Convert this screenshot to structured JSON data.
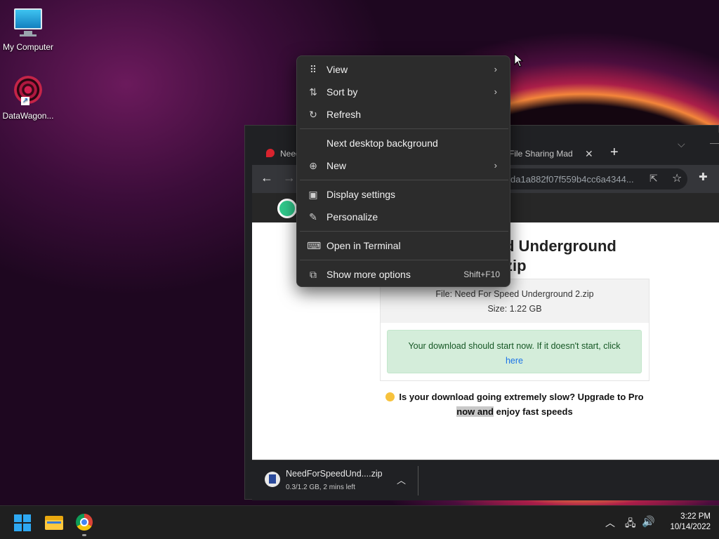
{
  "desktop": {
    "icons": [
      {
        "label": "My Computer",
        "icon": "monitor-icon"
      },
      {
        "label": "DataWagon...",
        "icon": "datawagon-icon"
      }
    ]
  },
  "browser": {
    "tabs": [
      {
        "label": "Need"
      },
      {
        "label": "File Sharing Made"
      }
    ],
    "url": "da1a882f07f559b4cc6a4344...",
    "page": {
      "title": "d Underground\nzip",
      "file_line": "File: Need For Speed Underground 2.zip",
      "size_line": "Size: 1.22 GB",
      "notice": "Your download should start now. If it doesn't start, click",
      "notice_link": "here",
      "promo_part1": "Is your download going extremely slow? Upgrade to Pro",
      "promo_highlight": "now and",
      "promo_part2": "enjoy fast speeds"
    },
    "download": {
      "filename": "NeedForSpeedUnd....zip",
      "status": "0.3/1.2 GB, 2 mins left"
    }
  },
  "context_menu": {
    "items": [
      {
        "label": "View",
        "icon": "view-grid-icon",
        "submenu": true
      },
      {
        "label": "Sort by",
        "icon": "sort-icon",
        "submenu": true
      },
      {
        "label": "Refresh",
        "icon": "refresh-icon"
      },
      {
        "label": "Next desktop background"
      },
      {
        "label": "New",
        "icon": "new-plus-icon",
        "submenu": true
      },
      {
        "label": "Display settings",
        "icon": "display-settings-icon"
      },
      {
        "label": "Personalize",
        "icon": "personalize-brush-icon"
      },
      {
        "label": "Open in Terminal",
        "icon": "terminal-icon"
      },
      {
        "label": "Show more options",
        "icon": "show-more-icon",
        "shortcut": "Shift+F10"
      }
    ]
  },
  "taskbar": {
    "apps": [
      "start",
      "file-explorer",
      "chrome"
    ],
    "clock": {
      "time": "3:22 PM",
      "date": "10/14/2022"
    }
  },
  "colors": {
    "menu_bg": "#2c2c2c",
    "taskbar_bg": "#1f1f1f",
    "accent_blue": "#2ea8f2",
    "notice_bg": "#d4edda"
  }
}
